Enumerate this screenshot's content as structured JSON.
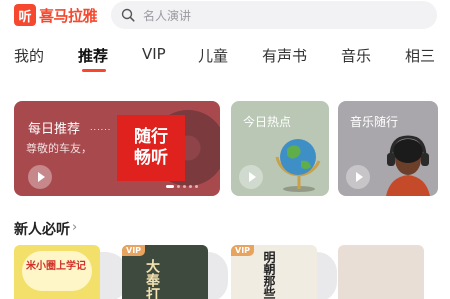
{
  "app": {
    "logo_glyph": "听",
    "name": "喜马拉雅",
    "brand_color": "#f5482e"
  },
  "search": {
    "placeholder": "名人演讲",
    "icon": "search-icon"
  },
  "tabs": [
    {
      "label": "我的",
      "active": false
    },
    {
      "label": "推荐",
      "active": true
    },
    {
      "label": "VIP",
      "active": false
    },
    {
      "label": "儿童",
      "active": false
    },
    {
      "label": "有声书",
      "active": false
    },
    {
      "label": "音乐",
      "active": false
    },
    {
      "label": "相三",
      "active": false
    }
  ],
  "cards": {
    "daily": {
      "title": "每日推荐",
      "dots": "......",
      "subtitle": "尊敬的车友，",
      "cover_line1": "随行",
      "cover_line2": "畅听",
      "color": "#a8494e"
    },
    "hot": {
      "title": "今日热点",
      "color": "#b9c7b4"
    },
    "music": {
      "title": "音乐随行",
      "color": "#a9a7ab"
    }
  },
  "section": {
    "title": "新人必听",
    "chevron": "›"
  },
  "books": [
    {
      "badge": "",
      "text": "米小圈上学记"
    },
    {
      "badge": "VIP",
      "text": "大奉打"
    },
    {
      "badge": "VIP",
      "text": "明朝那些"
    },
    {
      "badge": "",
      "text": ""
    }
  ]
}
